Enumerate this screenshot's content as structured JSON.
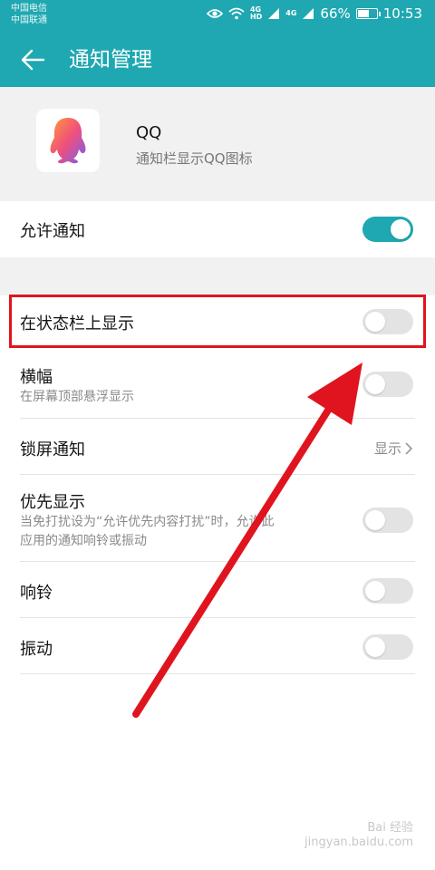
{
  "status_bar": {
    "carrier_1": "中国电信",
    "carrier_2": "中国联通",
    "net_1": [
      "4G",
      "HD"
    ],
    "net_2": "4G",
    "battery": "66%",
    "battery_level": 0.66,
    "time": "10:53"
  },
  "toolbar": {
    "title": "通知管理"
  },
  "app": {
    "name": "QQ",
    "description": "通知栏显示QQ图标"
  },
  "rows": {
    "allow": {
      "title": "允许通知",
      "state": "on"
    },
    "status_bar_display": {
      "title": "在状态栏上显示",
      "state": "off"
    },
    "banner": {
      "title": "横幅",
      "subtitle": "在屏幕顶部悬浮显示",
      "state": "off"
    },
    "lock_screen": {
      "title": "锁屏通知",
      "value": "显示"
    },
    "priority": {
      "title": "优先显示",
      "subtitle_line1": "当免打扰设为“允许优先内容打扰”时，允许此",
      "subtitle_line2": "应用的通知响铃或振动",
      "state": "off"
    },
    "ring": {
      "title": "响铃",
      "state": "off"
    },
    "vibrate": {
      "title": "振动",
      "state": "off"
    }
  },
  "colors": {
    "accent": "#1fa8b2",
    "annotation": "#e0141e"
  },
  "icons": [
    "eye-icon",
    "wifi-icon",
    "signal-icon",
    "battery-icon",
    "back-arrow-icon",
    "qq-penguin-icon",
    "chevron-right-icon"
  ],
  "watermark": {
    "line1": "Bai 经验",
    "line2": "jingyan.baidu.com"
  }
}
